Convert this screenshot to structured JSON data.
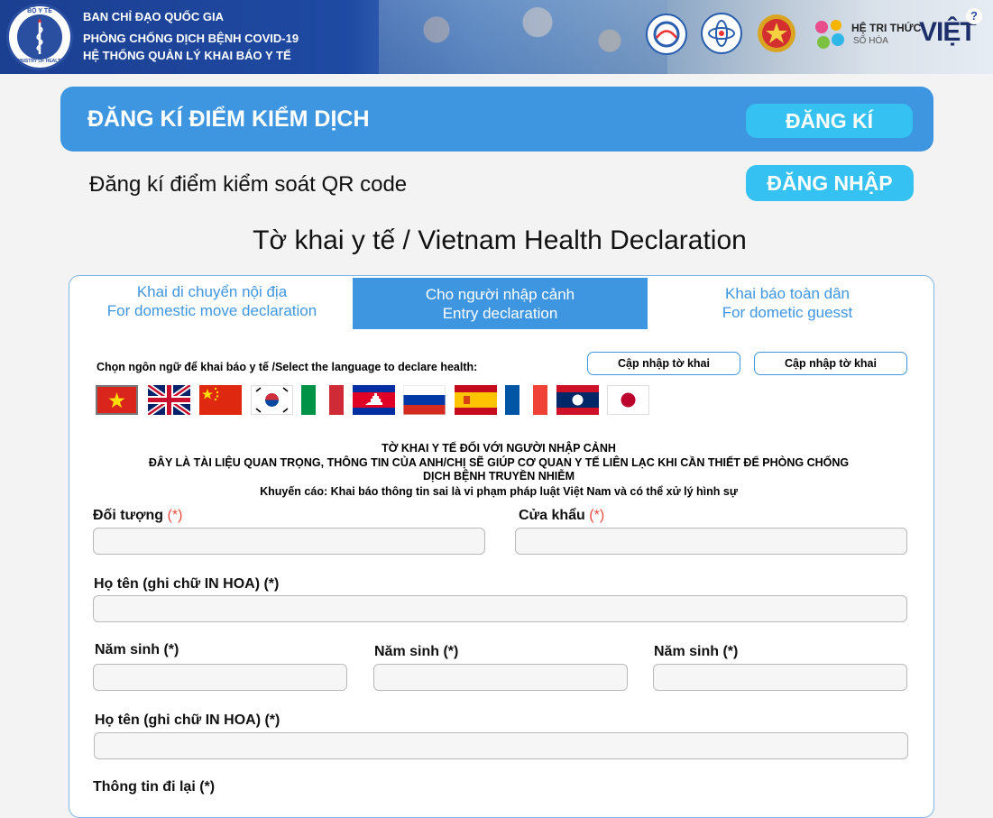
{
  "header": {
    "lines": [
      "BAN CHỈ ĐẠO QUỐC GIA",
      "PHÒNG CHỐNG DỊCH BỆNH COVID-19",
      "HỆ THỐNG QUẢN LÝ KHAI BÁO Y TẾ"
    ],
    "seal_top": "BỘ Y TẾ",
    "seal_bottom": "MINISTRY OF HEALTH",
    "brand_top": "HỆ TRI THỨC",
    "brand_sub": "SỐ HÓA",
    "brand_main": "VIỆT",
    "help": "?"
  },
  "banner": {
    "title": "ĐĂNG KÍ ĐIỂM KIỂM DỊCH",
    "register_button": "ĐĂNG KÍ"
  },
  "qr_text": "Đăng kí điểm kiểm soát QR code",
  "login_button": "ĐĂNG NHẬP",
  "page_title": "Tờ khai y tế / Vietnam Health Declaration",
  "tabs": [
    {
      "line1": "Khai di chuyển nội địa",
      "line2": "For domestic move declaration"
    },
    {
      "line1": "Cho người nhập cảnh",
      "line2": "Entry declaration"
    },
    {
      "line1": "Khai báo toàn dân",
      "line2": "For dometic guesst"
    }
  ],
  "language_label": "Chọn ngôn ngữ để khai báo y tế /Select the language to declare health:",
  "update_buttons": [
    "Cập nhập tờ khai",
    "Cập nhập tờ khai"
  ],
  "flags": [
    "vietnam-flag",
    "uk-flag",
    "china-flag",
    "korea-flag",
    "italy-flag",
    "cambodia-flag",
    "russia-flag",
    "spain-flag",
    "france-flag",
    "laos-flag",
    "japan-flag"
  ],
  "notice": {
    "title": "TỜ KHAI Y TẾ ĐỐI VỚI NGƯỜI NHẬP CẢNH",
    "line2": "ĐÂY LÀ TÀI LIỆU QUAN TRỌNG, THÔNG TIN CỦA ANH/CHỊ SẼ GIÚP CƠ QUAN Y TẾ LIÊN LẠC KHI CẦN THIẾT ĐỂ PHÒNG CHỐNG",
    "line3": "DỊCH BỆNH TRUYỀN NHIỄM",
    "warning": "Khuyến cáo: Khai báo thông tin sai là vi phạm pháp luật Việt Nam và có thể xử lý hình sự"
  },
  "form": {
    "doi_tuong": "Đối  tượng",
    "cua_khau": "Cửa khẩu",
    "required_mark": "(*)",
    "ho_ten": "Họ tên (ghi chữ IN HOA) (*)",
    "nam_sinh_1": "Năm sinh (*)",
    "nam_sinh_2": "Năm sinh (*)",
    "nam_sinh_3": "Năm sinh (*)",
    "ho_ten_2": "Họ tên (ghi chữ IN HOA) (*)",
    "thong_tin": "Thông tin đi lại (*)"
  },
  "colors": {
    "primary": "#3f96e0",
    "cyan": "#35c2f2",
    "required": "#e74c3c",
    "header_dark": "#1b3f91"
  }
}
